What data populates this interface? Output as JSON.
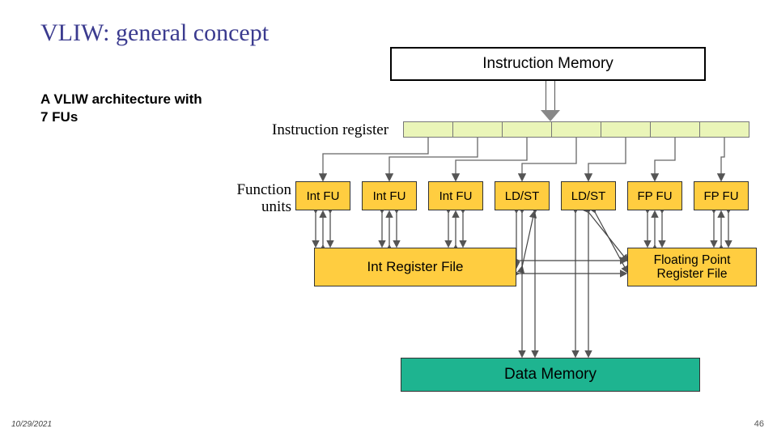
{
  "slide": {
    "title": "VLIW: general concept",
    "subtitle": "A VLIW architecture with 7 FUs"
  },
  "diagram": {
    "instruction_memory": "Instruction Memory",
    "instruction_register_label": "Instruction register",
    "function_units_label": "Function\nunits",
    "function_units": [
      "Int FU",
      "Int FU",
      "Int FU",
      "LD/ST",
      "LD/ST",
      "FP FU",
      "FP FU"
    ],
    "int_regfile": "Int Register File",
    "fp_regfile": "Floating Point\nRegister File",
    "data_memory": "Data Memory",
    "ir_slot_count": 7
  },
  "footer": {
    "date": "10/29/2021",
    "page": "46"
  }
}
